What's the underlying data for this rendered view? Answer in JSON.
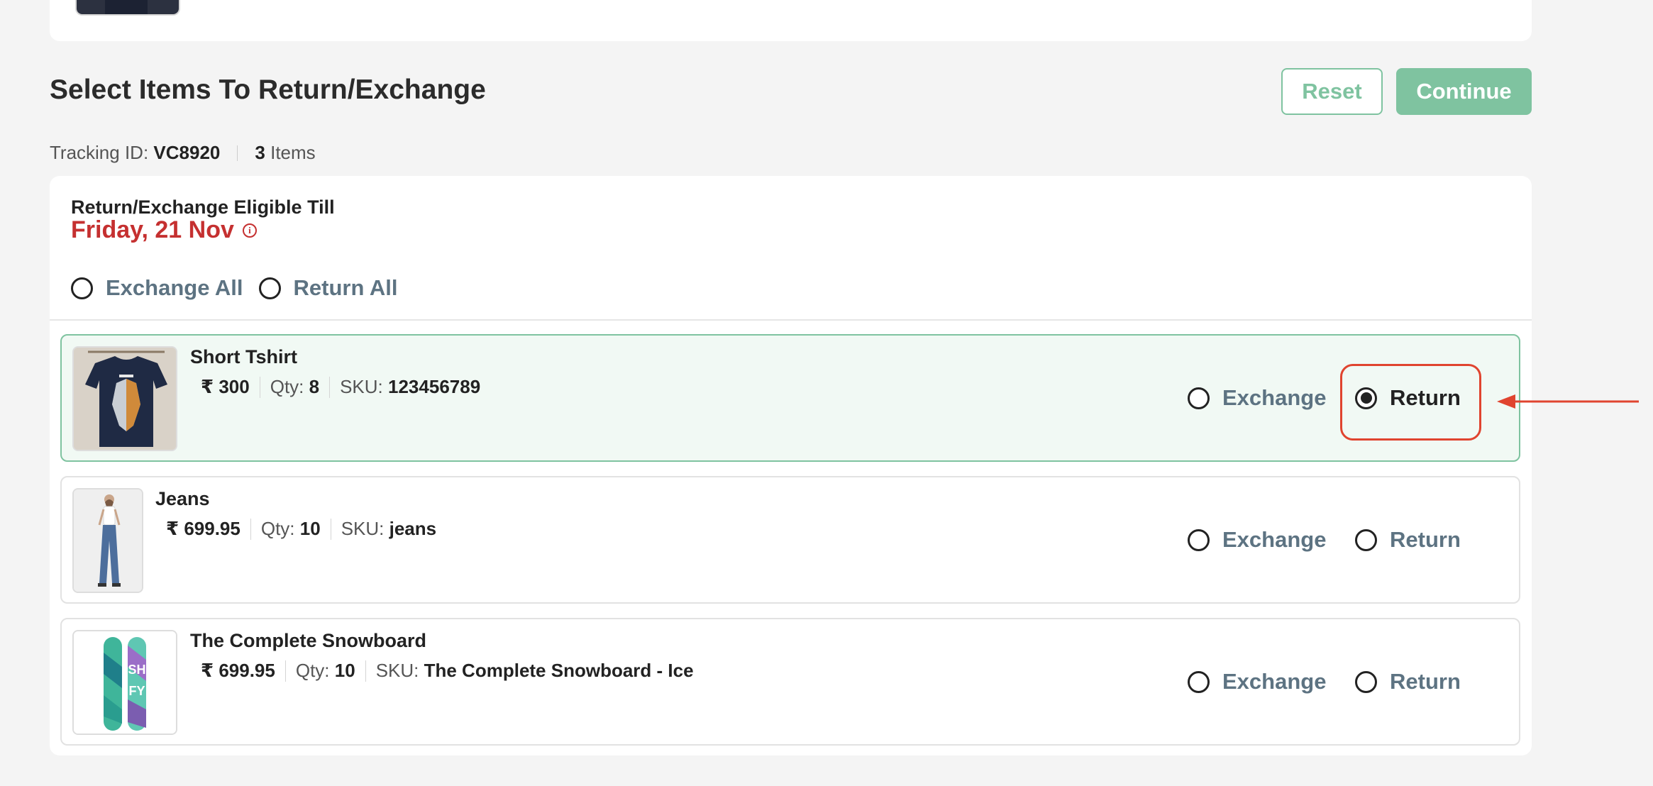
{
  "header": {
    "title": "Select Items To Return/Exchange",
    "reset_label": "Reset",
    "continue_label": "Continue"
  },
  "tracking": {
    "label": "Tracking ID:",
    "id": "VC8920",
    "count": "3",
    "count_label": "Items"
  },
  "eligibility": {
    "label": "Return/Exchange Eligible Till",
    "date": "Friday, 21 Nov",
    "info_icon": "i"
  },
  "bulk": {
    "exchange_all": "Exchange All",
    "return_all": "Return All"
  },
  "items": [
    {
      "name": "Short Tshirt",
      "currency": "₹",
      "price": "300",
      "qty_label": "Qty:",
      "qty": "8",
      "sku_label": "SKU:",
      "sku": "123456789",
      "exchange_label": "Exchange",
      "return_label": "Return",
      "selected": "return"
    },
    {
      "name": "Jeans",
      "currency": "₹",
      "price": "699.95",
      "qty_label": "Qty:",
      "qty": "10",
      "sku_label": "SKU:",
      "sku": "jeans",
      "exchange_label": "Exchange",
      "return_label": "Return",
      "selected": "none"
    },
    {
      "name": "The Complete Snowboard",
      "currency": "₹",
      "price": "699.95",
      "qty_label": "Qty:",
      "qty": "10",
      "sku_label": "SKU:",
      "sku": "The Complete Snowboard - Ice",
      "exchange_label": "Exchange",
      "return_label": "Return",
      "selected": "none"
    }
  ],
  "colors": {
    "accent_green": "#7fc3a0",
    "date_red": "#c53030",
    "annotation_red": "#e0442f",
    "option_slate": "#5d7382"
  }
}
